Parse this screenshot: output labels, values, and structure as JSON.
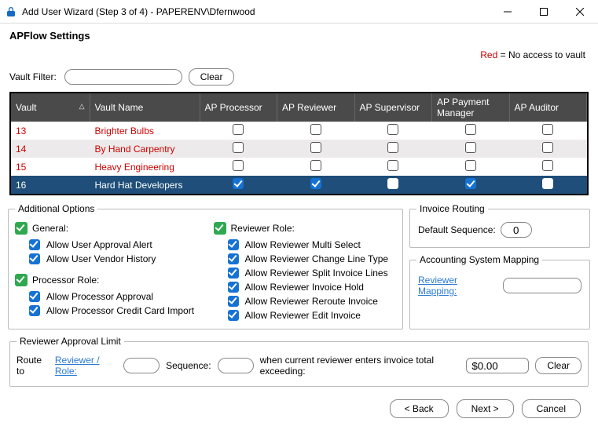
{
  "window": {
    "title": "Add User Wizard (Step 3 of 4) - PAPERENV\\Dfernwood"
  },
  "page": {
    "subtitle": "APFlow Settings",
    "legend_red": "Red",
    "legend_text": " = No access to vault"
  },
  "filter": {
    "label": "Vault Filter:",
    "value": "",
    "clear": "Clear"
  },
  "grid": {
    "columns": [
      "Vault",
      "Vault Name",
      "AP Processor",
      "AP Reviewer",
      "AP Supervisor",
      "AP Payment Manager",
      "AP Auditor"
    ],
    "rows": [
      {
        "id": "13",
        "name": "Brighter Bulbs",
        "no_access": true,
        "checks": [
          false,
          false,
          false,
          false,
          false
        ],
        "selected": false
      },
      {
        "id": "14",
        "name": "By Hand Carpentry",
        "no_access": true,
        "checks": [
          false,
          false,
          false,
          false,
          false
        ],
        "selected": false
      },
      {
        "id": "15",
        "name": "Heavy Engineering",
        "no_access": true,
        "checks": [
          false,
          false,
          false,
          false,
          false
        ],
        "selected": false
      },
      {
        "id": "16",
        "name": "Hard Hat Developers",
        "no_access": false,
        "checks": [
          true,
          true,
          false,
          true,
          false
        ],
        "selected": true
      }
    ]
  },
  "additional": {
    "legend": "Additional Options",
    "general": {
      "head": "General:",
      "items": [
        "Allow User Approval Alert",
        "Allow User Vendor History"
      ]
    },
    "processor": {
      "head": "Processor Role:",
      "items": [
        "Allow Processor Approval",
        "Allow Processor Credit Card Import"
      ]
    },
    "reviewer": {
      "head": "Reviewer Role:",
      "items": [
        "Allow Reviewer Multi Select",
        "Allow Reviewer Change Line Type",
        "Allow Reviewer Split Invoice Lines",
        "Allow Reviewer Invoice Hold",
        "Allow Reviewer Reroute Invoice",
        "Allow Reviewer Edit Invoice"
      ]
    }
  },
  "routing": {
    "legend": "Invoice Routing",
    "label": "Default Sequence:",
    "value": "0"
  },
  "mapping": {
    "legend": "Accounting System Mapping",
    "link": "Reviewer Mapping:",
    "value": ""
  },
  "ral": {
    "legend": "Reviewer Approval Limit",
    "route_to": "Route to",
    "link": "Reviewer / Role:",
    "role_value": "",
    "seq_label": "Sequence:",
    "seq_value": "",
    "tail": "when current reviewer enters invoice total exceeding:",
    "amount": "$0.00",
    "clear": "Clear"
  },
  "footer": {
    "back": "< Back",
    "next": "Next >",
    "cancel": "Cancel"
  }
}
